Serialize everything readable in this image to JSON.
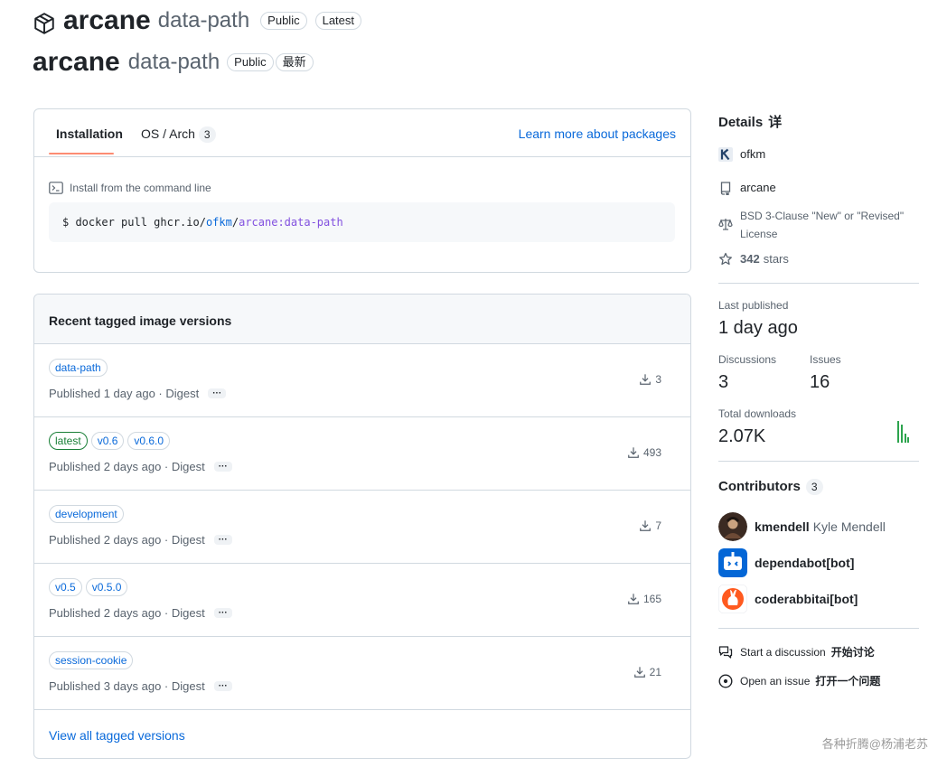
{
  "header": {
    "package_name": "arcane",
    "tag": "data-path",
    "visibility": "Public",
    "latest_badge_en": "Latest",
    "latest_badge_cn": "最新"
  },
  "install": {
    "tabs": [
      {
        "label": "Installation"
      },
      {
        "label": "OS / Arch",
        "count": "3"
      }
    ],
    "learn_more": "Learn more about packages",
    "command_label": "Install from the command line",
    "command": {
      "prefix": "$ docker pull ghcr.io/",
      "owner": "ofkm",
      "slash": "/",
      "image": "arcane:data-path"
    }
  },
  "versions": {
    "title": "Recent tagged image versions",
    "rows": [
      {
        "tags": [
          "data-path"
        ],
        "published": "Published 1 day ago · Digest",
        "downloads": "3"
      },
      {
        "tags": [
          "latest",
          "v0.6",
          "v0.6.0"
        ],
        "published": "Published 2 days ago · Digest",
        "downloads": "493"
      },
      {
        "tags": [
          "development"
        ],
        "published": "Published 2 days ago · Digest",
        "downloads": "7"
      },
      {
        "tags": [
          "v0.5",
          "v0.5.0"
        ],
        "published": "Published 2 days ago · Digest",
        "downloads": "165"
      },
      {
        "tags": [
          "session-cookie"
        ],
        "published": "Published 3 days ago · Digest",
        "downloads": "21"
      }
    ],
    "digest_more": "···",
    "view_all": "View all tagged versions"
  },
  "details": {
    "title": "Details",
    "title_cn": "详",
    "owner": "ofkm",
    "repo": "arcane",
    "license": "BSD 3-Clause \"New\" or \"Revised\" License",
    "stars_count": "342",
    "stars_label": "stars",
    "last_published_label": "Last published",
    "last_published": "1 day ago",
    "discussions_label": "Discussions",
    "discussions": "3",
    "issues_label": "Issues",
    "issues": "16",
    "total_downloads_label": "Total downloads",
    "total_downloads": "2.07K"
  },
  "contributors": {
    "title": "Contributors",
    "count": "3",
    "people": [
      {
        "login": "kmendell",
        "name": "Kyle Mendell"
      },
      {
        "login": "dependabot[bot]",
        "name": ""
      },
      {
        "login": "coderabbitai[bot]",
        "name": ""
      }
    ]
  },
  "actions": {
    "discussion_en": "Start a discussion",
    "discussion_cn": "开始讨论",
    "issue_en": "Open an issue",
    "issue_cn": "打开一个问题"
  },
  "watermark": "各种折腾@杨浦老苏",
  "colors": {
    "link": "#0969da",
    "border": "#d1d9e0",
    "tab_underline": "#fd8c73",
    "latest_green": "#1a7f37",
    "command_purple": "#8250df"
  }
}
